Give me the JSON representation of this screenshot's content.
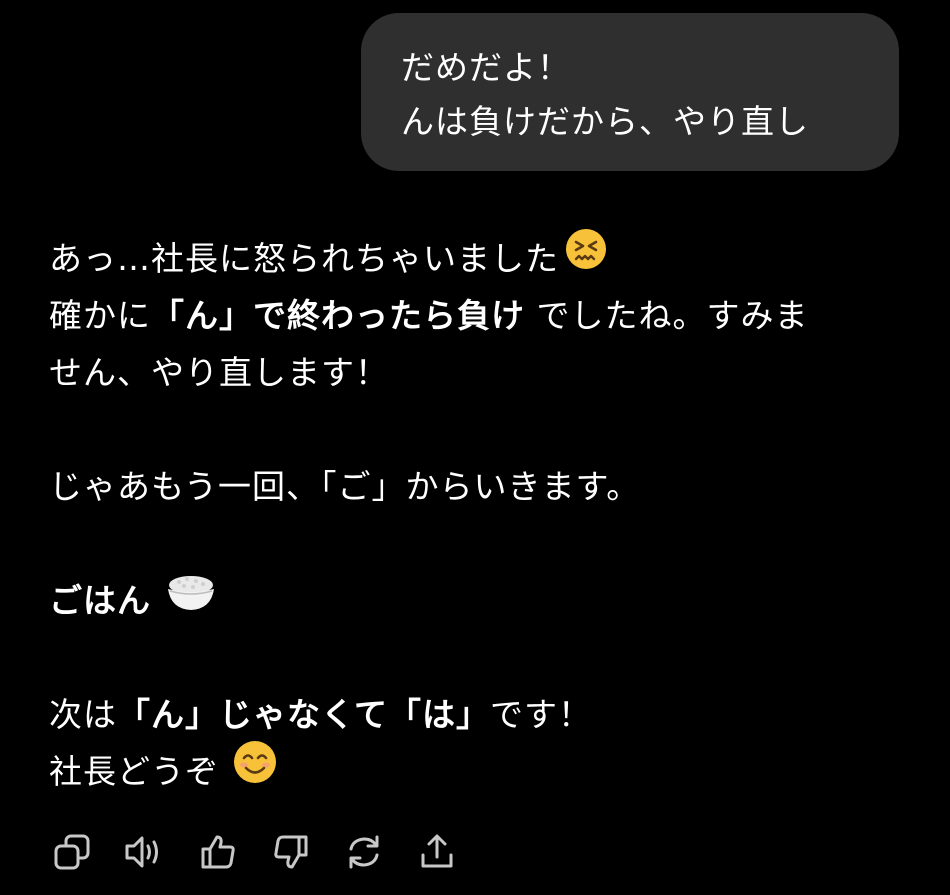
{
  "user_message": {
    "line1": "だめだよ！",
    "line2": "んは負けだから、やり直し"
  },
  "assistant_message": {
    "p1": {
      "text": "あっ…社長に怒られちゃいました",
      "emoji": "confounded-face"
    },
    "p2": {
      "prefix": "確かに",
      "bold": "「ん」で終わったら負け",
      "suffix": " でしたね。すみま"
    },
    "p3": "せん、やり直します！",
    "p4": "じゃあもう一回、「ご」からいきます。",
    "p5": {
      "bold": "ごはん",
      "emoji": "rice-bowl"
    },
    "p6": {
      "prefix": "次は",
      "bold1": "「ん」じゃなくて",
      "bold2": "「は」",
      "suffix": "です！"
    },
    "p7": {
      "text": "社長どうぞ",
      "emoji": "smiling-face"
    }
  },
  "actions": [
    {
      "icon": "copy-icon"
    },
    {
      "icon": "speaker-icon"
    },
    {
      "icon": "thumbs-up-icon"
    },
    {
      "icon": "thumbs-down-icon"
    },
    {
      "icon": "regenerate-icon"
    },
    {
      "icon": "share-icon"
    }
  ],
  "colors": {
    "background": "#000000",
    "bubble": "#2f2f2f",
    "text": "#ffffff",
    "icon": "#c8c8c8"
  }
}
